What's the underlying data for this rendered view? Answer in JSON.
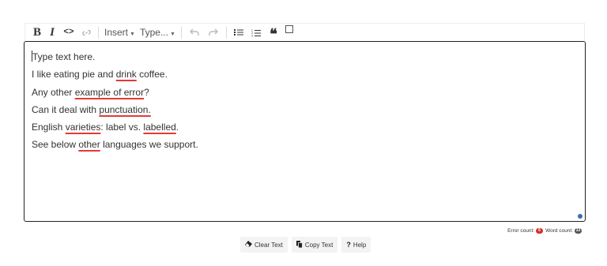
{
  "toolbar": {
    "bold_label": "B",
    "italic_label": "I",
    "code_label": "<>",
    "insert_label": "Insert",
    "type_label": "Type..."
  },
  "editor": {
    "lines": [
      "Type text here.",
      "I like eating pie and drink coffee.",
      "Any other example of error?",
      "Can it deal with punctuation.",
      "English varieties: label vs. labelled.",
      "See below other languages we support."
    ],
    "l1": {
      "a": "I like eating pie and ",
      "e": "drink",
      "b": " coffee."
    },
    "l2": {
      "a": "Any other ",
      "e": "example of error",
      "b": "?"
    },
    "l3": {
      "a": "Can it deal with ",
      "e": "punctuation.",
      "b": ""
    },
    "l4": {
      "a": "English ",
      "e1": "varieties",
      "m": ": label vs. ",
      "e2": "labelled",
      "b": "."
    },
    "l5": {
      "a": "See below ",
      "e": "other",
      "b": " languages we support."
    }
  },
  "status": {
    "error_count_label": "Error count:",
    "error_count": "6",
    "word_count_label": "Word count:",
    "word_count": "33"
  },
  "actions": {
    "clear_label": "Clear Text",
    "copy_label": "Copy Text",
    "help_label": "Help"
  },
  "colors": {
    "error_underline": "#e53935",
    "error_badge": "#d32f2f",
    "word_badge": "#555555",
    "resize_handle": "#3f6db0"
  }
}
